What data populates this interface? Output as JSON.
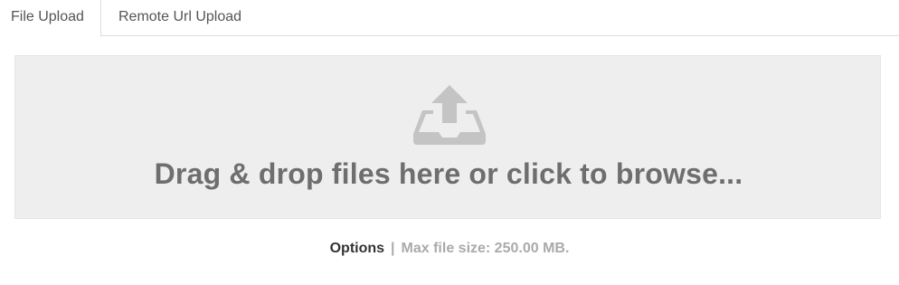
{
  "tabs": [
    {
      "label": "File Upload",
      "active": true
    },
    {
      "label": "Remote Url Upload",
      "active": false
    }
  ],
  "dropzone": {
    "icon": "upload-tray-icon",
    "message": "Drag & drop files here or click to browse..."
  },
  "footer": {
    "options_label": "Options",
    "separator": "|",
    "max_size_text": "Max file size: 250.00 MB."
  },
  "colors": {
    "dropzone_bg": "#eeeeee",
    "icon": "#c4c4c4",
    "message_text": "#6e6e6e",
    "muted_text": "#aaaaaa"
  }
}
